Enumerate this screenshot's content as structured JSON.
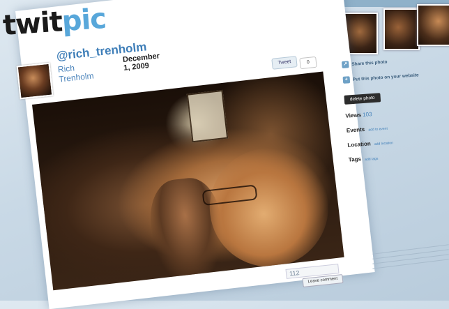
{
  "brand": {
    "logo_part1": "twit",
    "logo_part2": "pic"
  },
  "tweet": {
    "label": "Tweet",
    "count": "0"
  },
  "photo_header": {
    "username": "@rich_trenholm",
    "realname": "Rich Trenholm",
    "date": "December 1, 2009"
  },
  "sidebar": {
    "share_label": "Share this photo",
    "put_label": "Put this photo on your website",
    "delete_label": "delete photo",
    "views_label": "Views",
    "views_value": "103",
    "events_label": "Events",
    "events_add": "add to event",
    "location_label": "Location",
    "location_add": "add location",
    "tags_label": "Tags",
    "tags_add": "add tags"
  },
  "comments": {
    "count_value": "112",
    "leave_button": "Leave comment"
  },
  "colors": {
    "link_blue": "#3e7eb8",
    "logo_pic": "#58a7da"
  }
}
